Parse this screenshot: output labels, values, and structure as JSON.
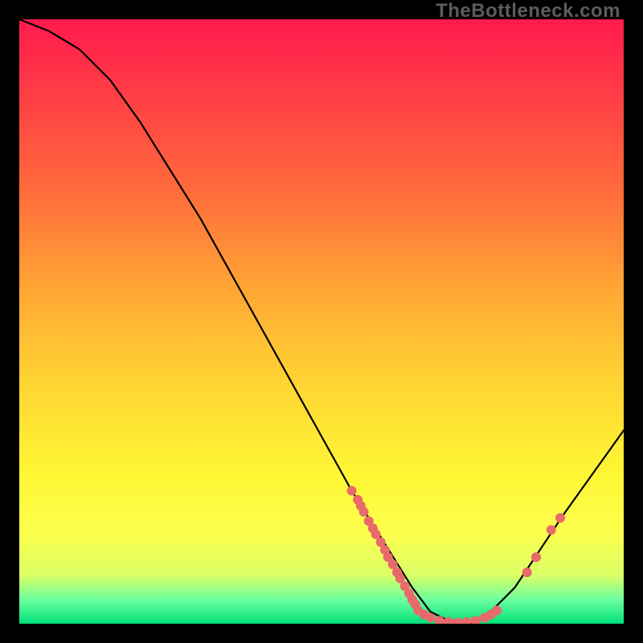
{
  "watermark": "TheBottleneck.com",
  "chart_data": {
    "type": "line",
    "title": "",
    "xlabel": "",
    "ylabel": "",
    "xlim": [
      0,
      100
    ],
    "ylim": [
      0,
      100
    ],
    "curve": {
      "comment": "Approximate valley curve; y = 0 at x≈68–78, rising to ~100 at x=0 and ~32 at x=100",
      "x": [
        0,
        5,
        10,
        15,
        20,
        25,
        30,
        35,
        40,
        45,
        50,
        55,
        60,
        65,
        68,
        72,
        75,
        78,
        82,
        86,
        90,
        95,
        100
      ],
      "y": [
        100,
        98,
        95,
        90,
        83,
        75,
        67,
        58,
        49,
        40,
        31,
        22,
        14,
        6,
        2,
        0,
        0,
        2,
        6,
        12,
        18,
        25,
        32
      ]
    },
    "points_left_branch": {
      "comment": "Pink data dots clustered on descending branch",
      "x": [
        55,
        56,
        56.5,
        57,
        57.8,
        58.5,
        59,
        59.8,
        60.5,
        61,
        61.8,
        62.5,
        63,
        63.8,
        64.5,
        65,
        65.5
      ],
      "y": [
        22,
        20.5,
        19.5,
        18.5,
        17,
        15.8,
        14.8,
        13.5,
        12.2,
        11,
        9.8,
        8.5,
        7.5,
        6.2,
        5,
        4,
        3.2
      ]
    },
    "points_bottom": {
      "comment": "Pink data dots along trough",
      "x": [
        66,
        67,
        68,
        69.5,
        71,
        72.5,
        74,
        75.5,
        77,
        78,
        79
      ],
      "y": [
        2.2,
        1.5,
        1.0,
        0.5,
        0.3,
        0.2,
        0.3,
        0.5,
        1.0,
        1.5,
        2.2
      ]
    },
    "points_right_branch": {
      "comment": "Pink data dots on ascending branch",
      "x": [
        84,
        85.5,
        88,
        89.5
      ],
      "y": [
        8.5,
        11,
        15.5,
        17.5
      ]
    }
  }
}
